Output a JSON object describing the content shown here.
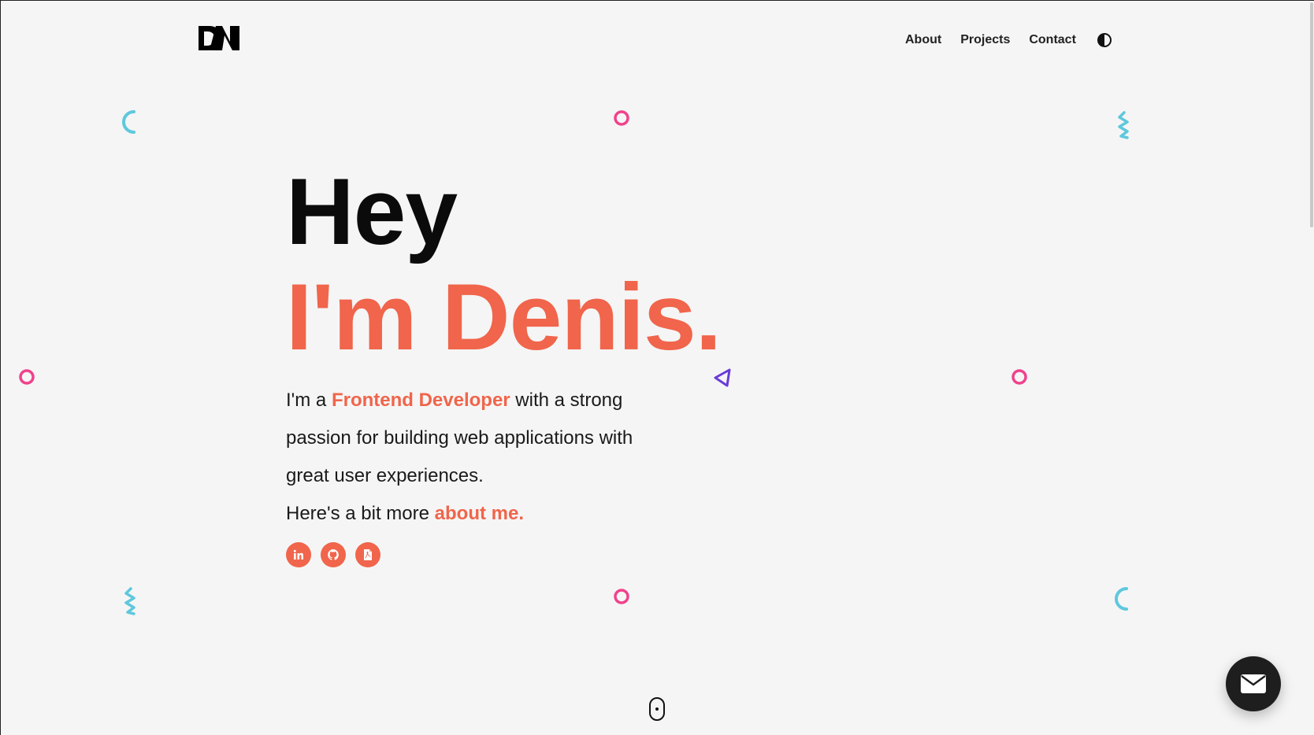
{
  "logo": {
    "alt": "DN"
  },
  "nav": {
    "items": [
      {
        "label": "About"
      },
      {
        "label": "Projects"
      },
      {
        "label": "Contact"
      }
    ],
    "theme_toggle_icon": "contrast-icon"
  },
  "hero": {
    "greeting": "Hey",
    "name_line": "I'm Denis.",
    "intro_prefix": "I'm a ",
    "intro_role": "Frontend Developer",
    "intro_suffix": " with a strong passion for building web applications with great user experiences.",
    "more_prefix": "Here's a bit more ",
    "more_link": "about me."
  },
  "socials": [
    {
      "icon": "linkedin-icon"
    },
    {
      "icon": "github-icon"
    },
    {
      "icon": "resume-icon"
    }
  ],
  "colors": {
    "accent": "#f0654b",
    "pink": "#f0428c",
    "cyan": "#5ec8dc",
    "purple": "#6a3bd8",
    "dark": "#1e1e1e",
    "background": "#f5f5f5"
  },
  "fab": {
    "icon": "mail-icon"
  },
  "scroll_indicator": {
    "icon": "mouse-icon"
  }
}
